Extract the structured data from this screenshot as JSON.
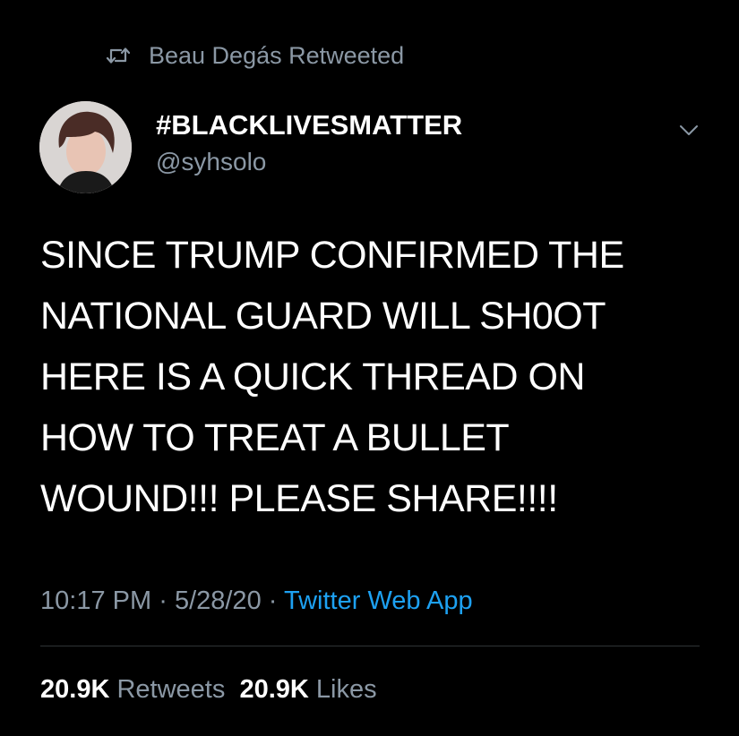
{
  "retweet_header": {
    "text": "Beau Degás Retweeted",
    "icon": "retweet-icon"
  },
  "tweet": {
    "display_name": "#BLACKLIVESMATTER",
    "handle": "@syhsolo",
    "text_lines": [
      "SINCE TRUMP CONFIRMED THE",
      "NATIONAL GUARD WILL SH0OT",
      "HERE IS A QUICK THREAD ON",
      "HOW TO TREAT A BULLET",
      "WOUND!!! PLEASE SHARE!!!!"
    ],
    "time": "10:17 PM",
    "separator": "·",
    "date": "5/28/20",
    "source": "Twitter Web App",
    "retweets_count": "20.9K",
    "retweets_label": "Retweets",
    "likes_count": "20.9K",
    "likes_label": "Likes"
  },
  "colors": {
    "background": "#000000",
    "text": "#ffffff",
    "secondary": "#8b98a5",
    "link": "#1da1f2",
    "divider": "#2f3336"
  },
  "icons": {
    "retweet": "retweet-icon",
    "avatar": "avatar",
    "more": "chevron-down-icon"
  }
}
